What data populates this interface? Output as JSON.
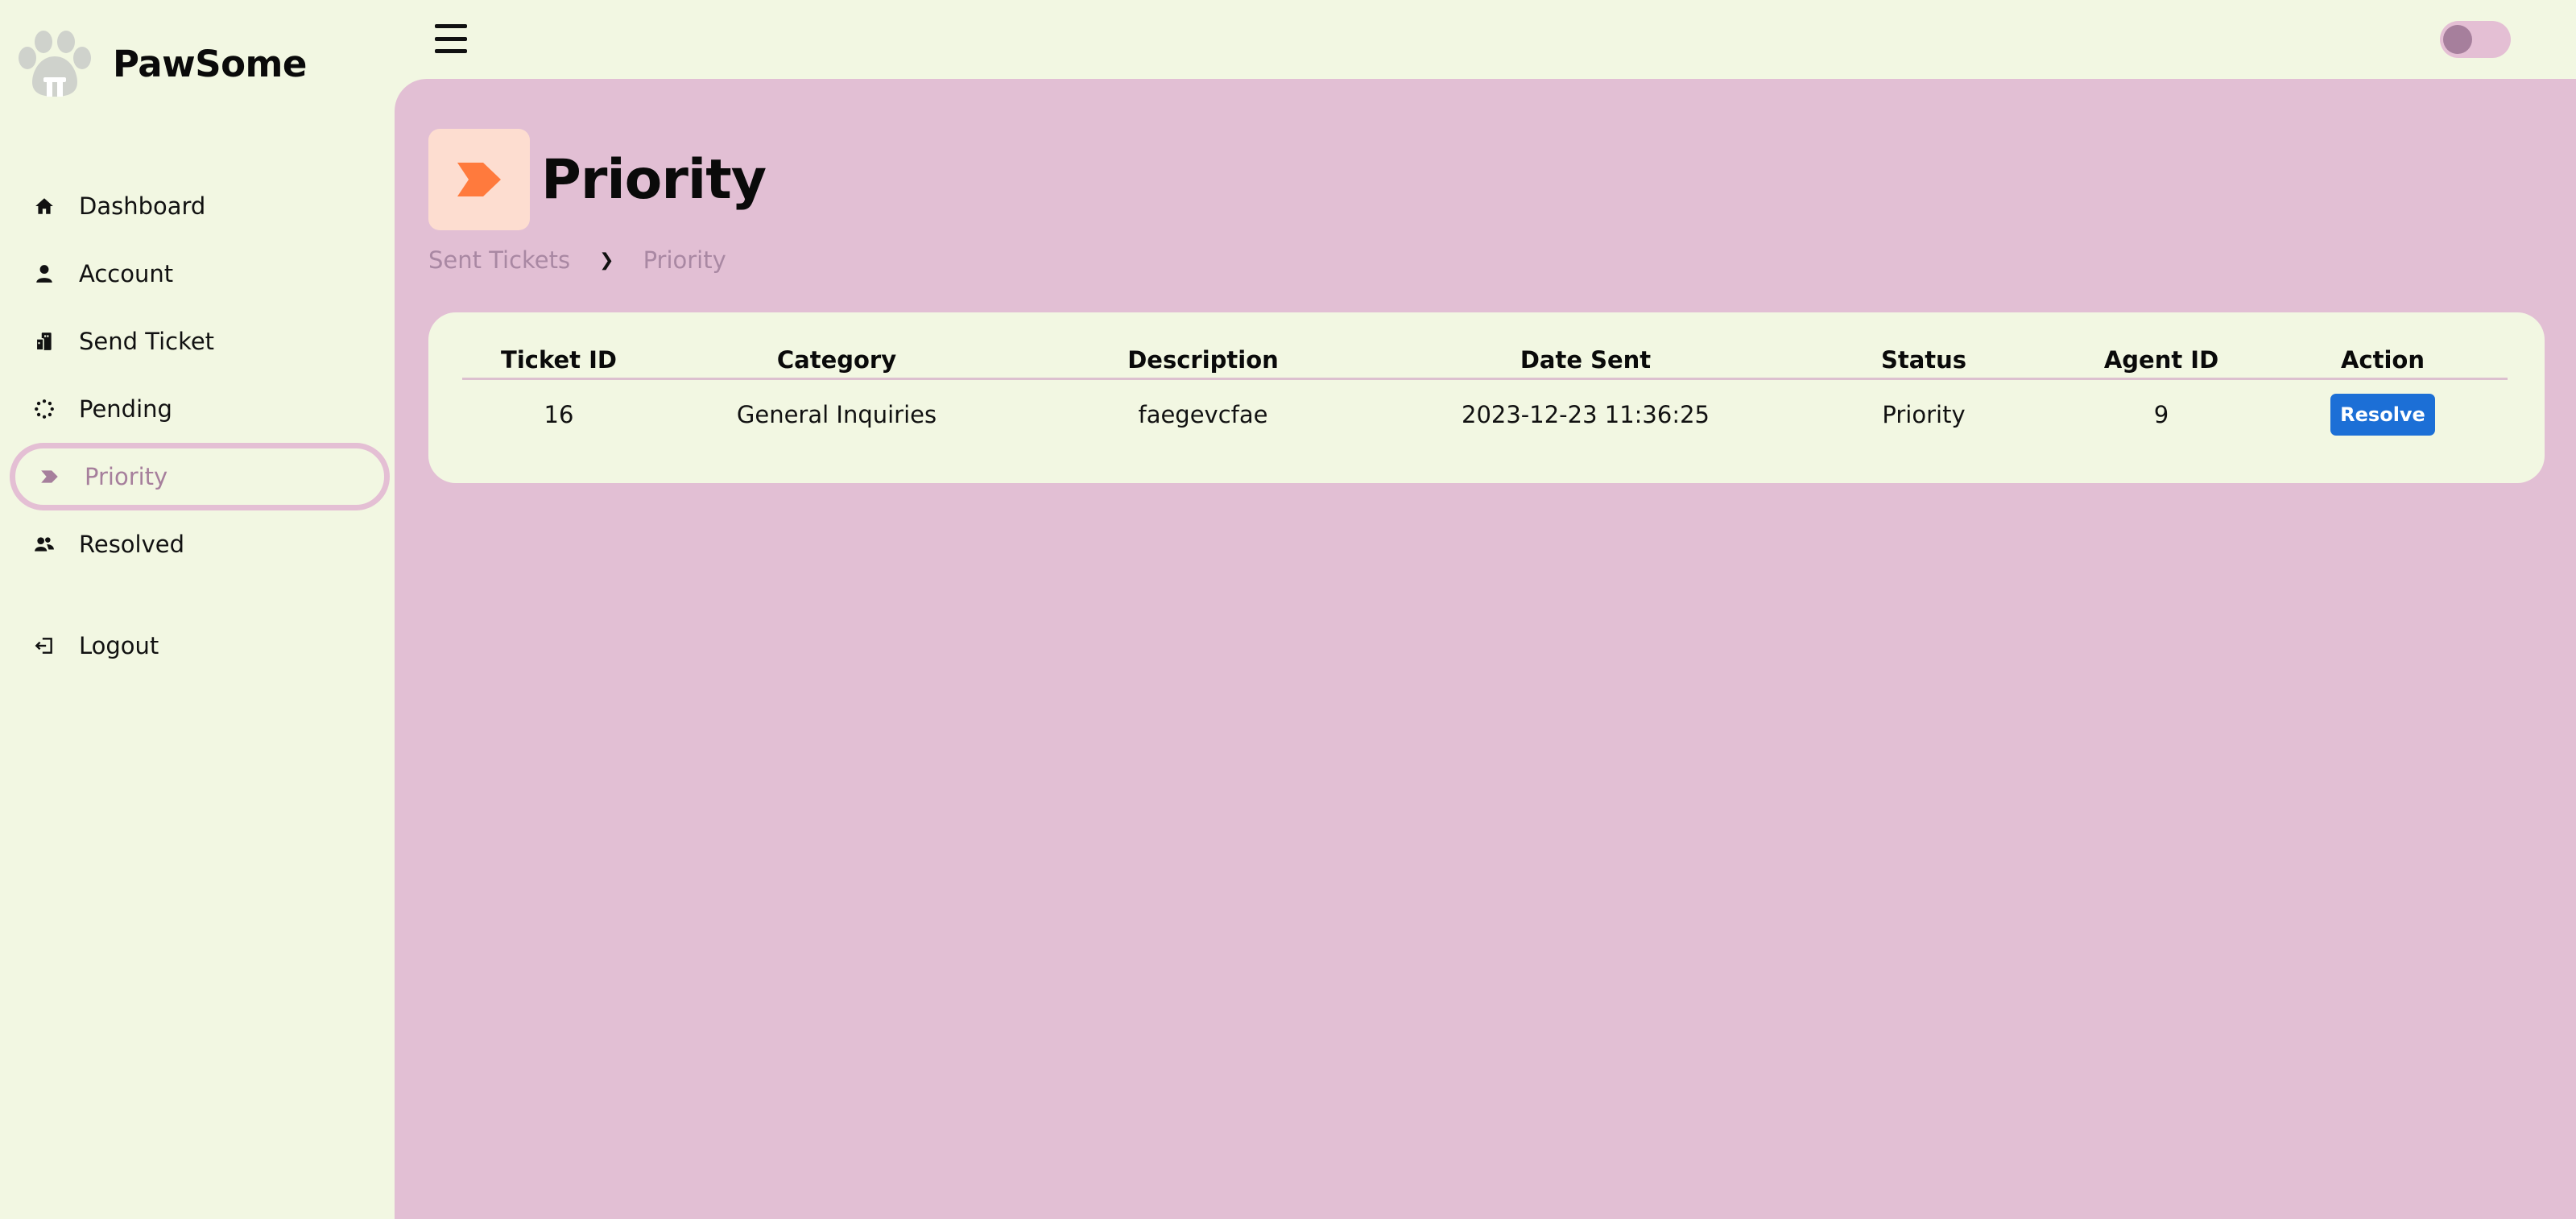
{
  "app": {
    "brand": "PawSome"
  },
  "sidebar": {
    "items": [
      {
        "label": "Dashboard",
        "icon": "home-icon"
      },
      {
        "label": "Account",
        "icon": "user-icon"
      },
      {
        "label": "Send Ticket",
        "icon": "ticket-icon"
      },
      {
        "label": "Pending",
        "icon": "spinner-icon"
      },
      {
        "label": "Priority",
        "icon": "chevron-tag-icon",
        "active": true
      },
      {
        "label": "Resolved",
        "icon": "users-check-icon"
      }
    ],
    "logout": {
      "label": "Logout",
      "icon": "logout-icon"
    }
  },
  "header": {
    "menu_icon": "hamburger-icon",
    "theme_toggle": "off"
  },
  "page": {
    "title": "Priority",
    "breadcrumb": [
      "Sent Tickets",
      "Priority"
    ]
  },
  "table": {
    "columns": [
      "Ticket ID",
      "Category",
      "Description",
      "Date Sent",
      "Status",
      "Agent ID",
      "Action"
    ],
    "rows": [
      {
        "ticket_id": "16",
        "category": "General Inquiries",
        "description": "faegevcfae",
        "date_sent": "2023-12-23 11:36:25",
        "status": "Priority",
        "agent_id": "9",
        "action": "Resolve"
      }
    ]
  },
  "colors": {
    "background": "#f2f7e2",
    "main_panel": "#e2bfd4",
    "accent": "#a67f9c",
    "priority_icon": "#ff7a3d",
    "resolve_button": "#1c6fd6"
  }
}
